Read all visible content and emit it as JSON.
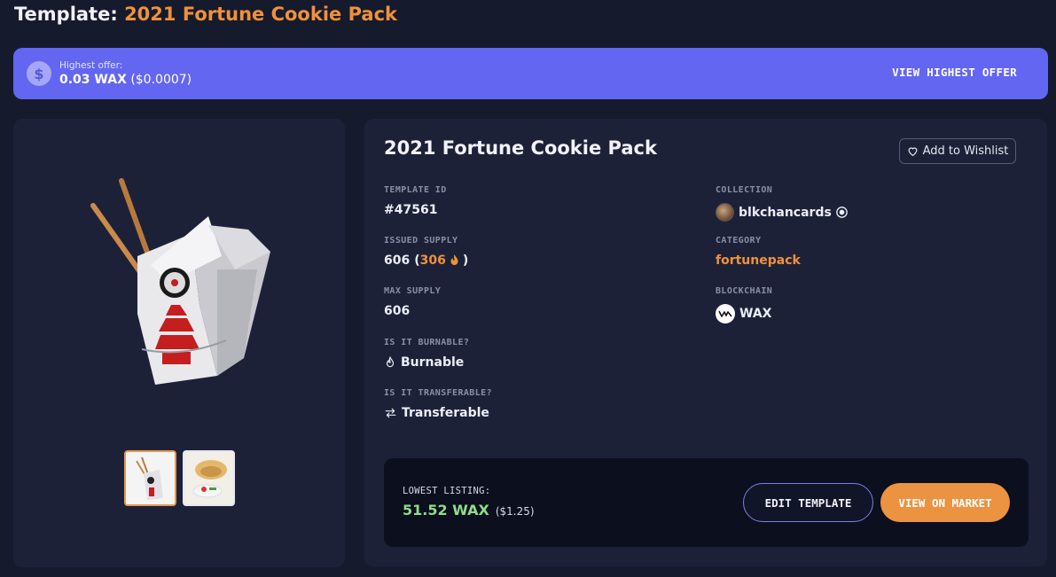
{
  "page": {
    "title_prefix": "Template:",
    "title_name": "2021 Fortune Cookie Pack"
  },
  "offer": {
    "icon": "dollar-icon",
    "label": "Highest offer:",
    "amount": "0.03 WAX",
    "usd": "($0.0007)",
    "button": "VIEW HIGHEST OFFER"
  },
  "details": {
    "name": "2021 Fortune Cookie Pack",
    "wishlist": "Add to Wishlist",
    "template_id": {
      "label": "TEMPLATE ID",
      "value": "#47561"
    },
    "issued_supply": {
      "label": "ISSUED SUPPLY",
      "value": "606",
      "burned_open": "(",
      "burned": "306",
      "burned_close": ")"
    },
    "max_supply": {
      "label": "MAX SUPPLY",
      "value": "606"
    },
    "burnable": {
      "label": "IS IT BURNABLE?",
      "value": "Burnable"
    },
    "transferable": {
      "label": "IS IT TRANSFERABLE?",
      "value": "Transferable"
    },
    "collection": {
      "label": "COLLECTION",
      "value": "blkchancards"
    },
    "category": {
      "label": "CATEGORY",
      "value": "fortunepack"
    },
    "blockchain": {
      "label": "BLOCKCHAIN",
      "value": "WAX"
    }
  },
  "market": {
    "lowest_label": "LOWEST LISTING:",
    "lowest_wax": "51.52 WAX",
    "lowest_usd": "($1.25)",
    "edit_button": "EDIT TEMPLATE",
    "market_button": "VIEW ON MARKET"
  },
  "colors": {
    "accent": "#f0913a",
    "offer_bar": "#6366f1",
    "price_green": "#8fdc8a",
    "background": "#161a2d",
    "panel": "#1d2138"
  }
}
